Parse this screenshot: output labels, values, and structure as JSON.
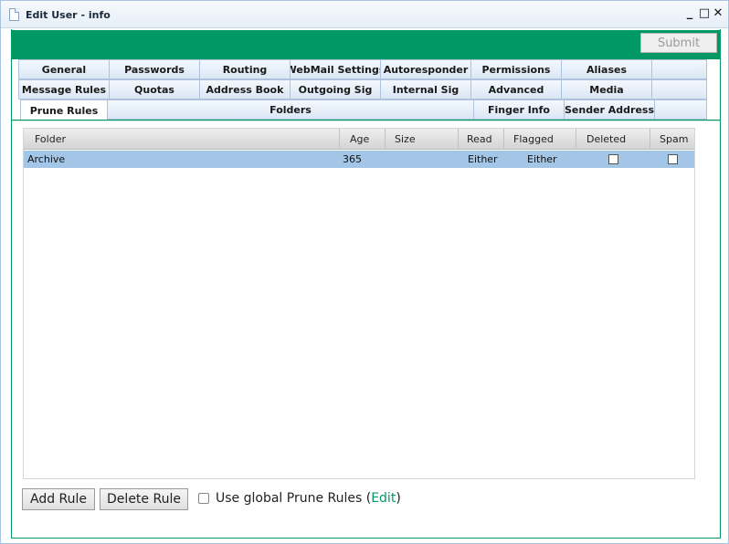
{
  "window": {
    "title": "Edit User - info",
    "minimize": "_",
    "maximize": "□",
    "close": "✕"
  },
  "toolbar": {
    "submit_label": "Submit"
  },
  "tabs": {
    "row1": [
      "General",
      "Passwords",
      "Routing",
      "WebMail Settings",
      "Autoresponder",
      "Permissions",
      "Aliases",
      ""
    ],
    "row2": [
      "Message Rules",
      "Quotas",
      "Address Book",
      "Outgoing Sig",
      "Internal Sig",
      "Advanced",
      "Media",
      ""
    ],
    "row3": [
      "Prune Rules",
      "Folders",
      "Finger Info",
      "Sender Address"
    ],
    "active": "Prune Rules"
  },
  "table": {
    "columns": [
      "Folder",
      "Age",
      "Size",
      "Read",
      "Flagged",
      "Deleted",
      "Spam"
    ],
    "rows": [
      {
        "folder": "Archive",
        "age": "365",
        "size": "",
        "read": "Either",
        "flagged": "Either",
        "deleted": false,
        "spam": false
      }
    ]
  },
  "footer": {
    "add_rule": "Add Rule",
    "delete_rule": "Delete Rule",
    "global_label_prefix": "Use global Prune Rules (",
    "edit_link": "Edit",
    "global_label_suffix": ")",
    "global_checked": false
  }
}
